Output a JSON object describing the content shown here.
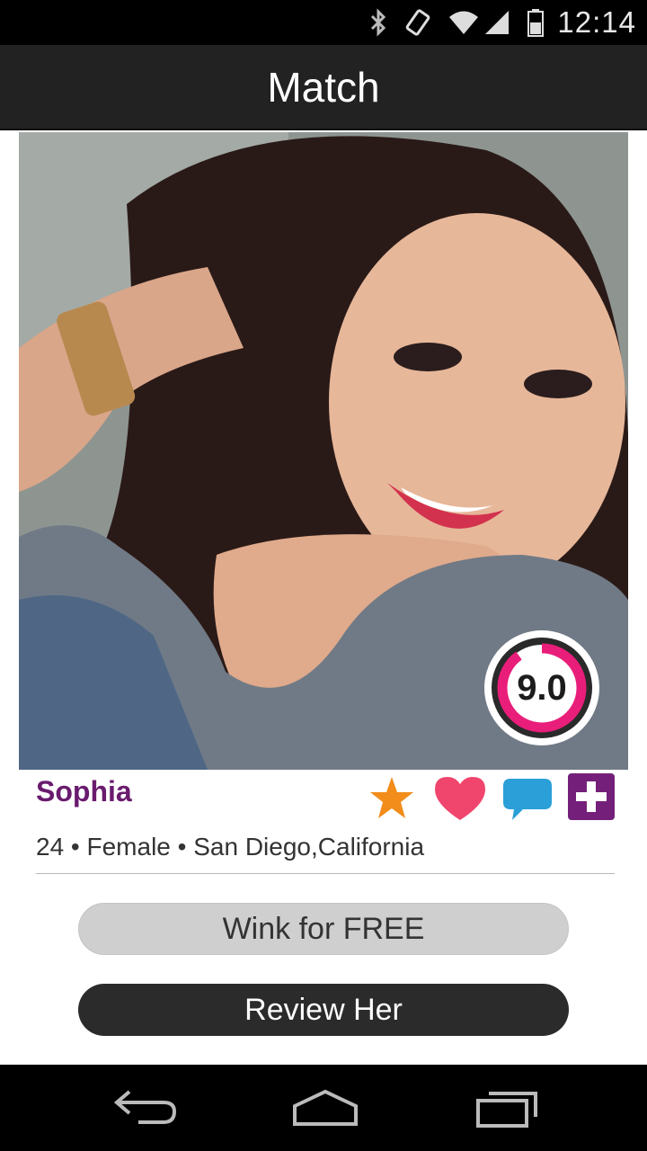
{
  "status_bar": {
    "time": "12:14",
    "icons": [
      "bluetooth-icon",
      "rotate-icon",
      "wifi-icon",
      "signal-icon",
      "battery-icon"
    ]
  },
  "header": {
    "title": "Match"
  },
  "profile": {
    "name": "Sophia",
    "details": "24 • Female • San Diego,California",
    "score": "9.0",
    "score_fraction": 0.9
  },
  "actions": [
    {
      "icon": "star-icon",
      "color": "#f28c1a"
    },
    {
      "icon": "heart-icon",
      "color": "#f0466e"
    },
    {
      "icon": "chat-bubble-icon",
      "color": "#2a9fd8"
    },
    {
      "icon": "plus-icon",
      "color": "#74207a"
    }
  ],
  "buttons": {
    "wink_label": "Wink for FREE",
    "review_label": "Review Her"
  },
  "nav_bar": {
    "icons": [
      "back-icon",
      "home-icon",
      "recent-apps-icon"
    ]
  },
  "colors": {
    "accent_name": "#6a1b6e",
    "score_ring": "#e91e7a",
    "header_bg": "#222222"
  }
}
